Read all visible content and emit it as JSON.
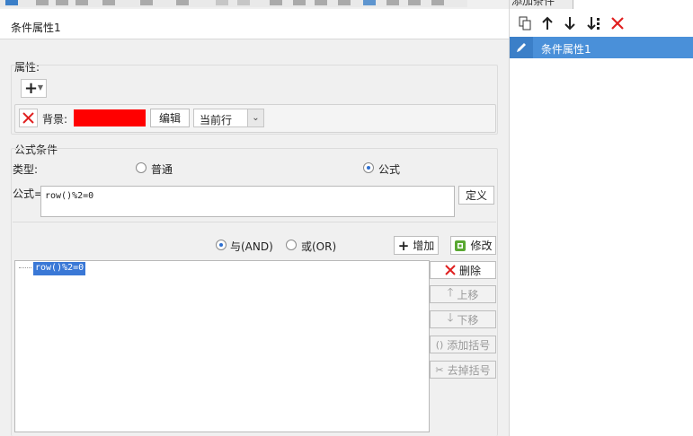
{
  "dialog_title": "条件属性1",
  "properties": {
    "label": "属性:",
    "add_symbol": "+",
    "background_label": "背景:",
    "background_color": "#ff0000",
    "edit_button": "编辑",
    "scope_value": "当前行"
  },
  "formula_condition": {
    "label": "公式条件",
    "type_label": "类型:",
    "type_normal": "普通",
    "type_formula": "公式",
    "formula_label": "公式=",
    "formula_value": "row()%2=0",
    "define_button": "定义"
  },
  "logic": {
    "and_label": "与(AND)",
    "or_label": "或(OR)",
    "add_button": "增加",
    "modify_button": "修改"
  },
  "condition_list": [
    "row()%2=0"
  ],
  "side_buttons": {
    "delete": "删除",
    "move_up": "上移",
    "move_down": "下移",
    "add_bracket": "添加括号",
    "remove_bracket": "去掉括号"
  },
  "right_panel": {
    "header_partial": "添加条件",
    "item_label": "条件属性1"
  },
  "colors": {
    "selection_blue": "#4a90d9",
    "delete_red": "#e02020"
  },
  "icons": [
    "copy-icon",
    "arrow-up-icon",
    "arrow-down-icon",
    "move-bottom-icon",
    "close-icon",
    "pencil-icon",
    "plus-icon",
    "modify-icon"
  ]
}
